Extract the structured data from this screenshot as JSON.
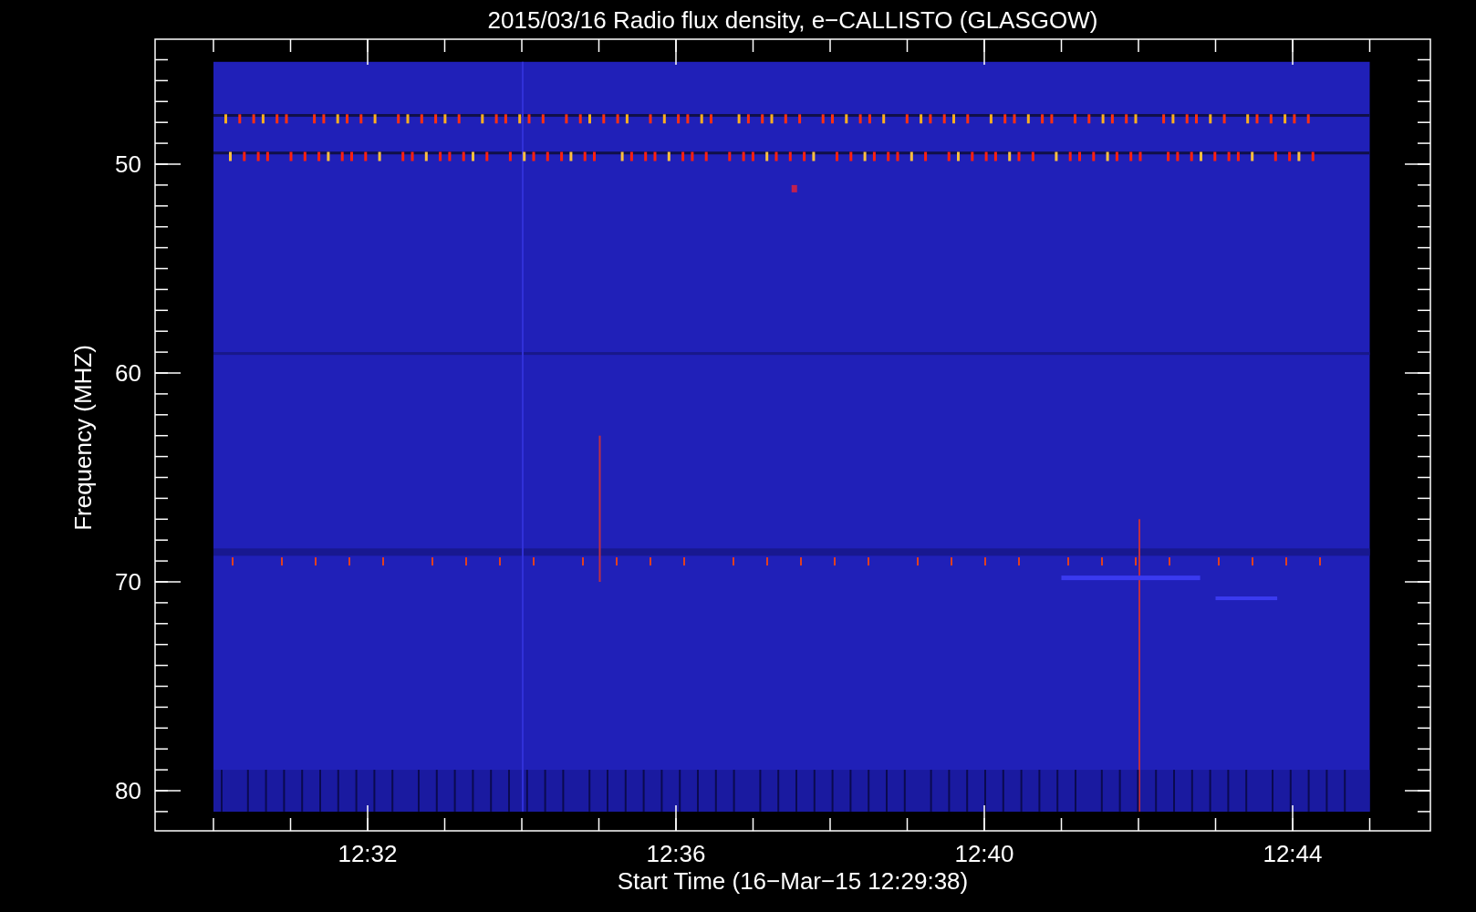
{
  "title": "2015/03/16  Radio flux density, e−CALLISTO (GLASGOW)",
  "plot": {
    "ylabel": "Frequency (MHZ)",
    "xlabel": "Start Time (16−Mar−15 12:29:38)",
    "yticks": [
      "50",
      "60",
      "70",
      "80"
    ],
    "xticks": [
      "12:32",
      "12:36",
      "12:40",
      "12:44"
    ]
  }
}
